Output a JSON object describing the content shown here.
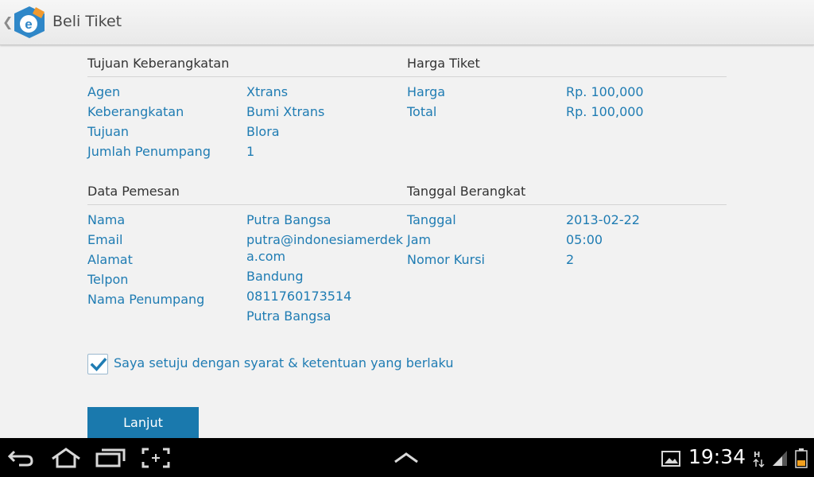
{
  "app": {
    "title": "Beli Tiket"
  },
  "sections": {
    "departure": {
      "header": "Tujuan Keberangkatan",
      "rows": [
        {
          "label": "Agen",
          "value": "Xtrans"
        },
        {
          "label": "Keberangkatan",
          "value": "Bumi Xtrans"
        },
        {
          "label": "Tujuan",
          "value": "Blora"
        },
        {
          "label": "Jumlah Penumpang",
          "value": "1"
        }
      ]
    },
    "price": {
      "header": "Harga Tiket",
      "rows": [
        {
          "label": "Harga",
          "value": "Rp. 100,000"
        },
        {
          "label": "Total",
          "value": "Rp. 100,000"
        }
      ]
    },
    "booker": {
      "header": "Data Pemesan",
      "rows": [
        {
          "label": "Nama",
          "value": "Putra Bangsa"
        },
        {
          "label": "Email",
          "value": "putra@indonesiamerdeka.com"
        },
        {
          "label": "Alamat",
          "value": "Bandung"
        },
        {
          "label": "Telpon",
          "value": "0811760173514"
        },
        {
          "label": "Nama Penumpang",
          "value": "Putra Bangsa"
        }
      ]
    },
    "date": {
      "header": "Tanggal Berangkat",
      "rows": [
        {
          "label": "Tanggal",
          "value": "2013-02-22"
        },
        {
          "label": "Jam",
          "value": "05:00"
        },
        {
          "label": "Nomor Kursi",
          "value": "2"
        }
      ]
    }
  },
  "agreement": {
    "text": "Saya setuju dengan syarat & ketentuan yang berlaku",
    "checked": true
  },
  "actions": {
    "next_label": "Lanjut"
  },
  "status": {
    "time": "19:34"
  },
  "colors": {
    "accent": "#1f7cb3",
    "button": "#1a79ad"
  }
}
